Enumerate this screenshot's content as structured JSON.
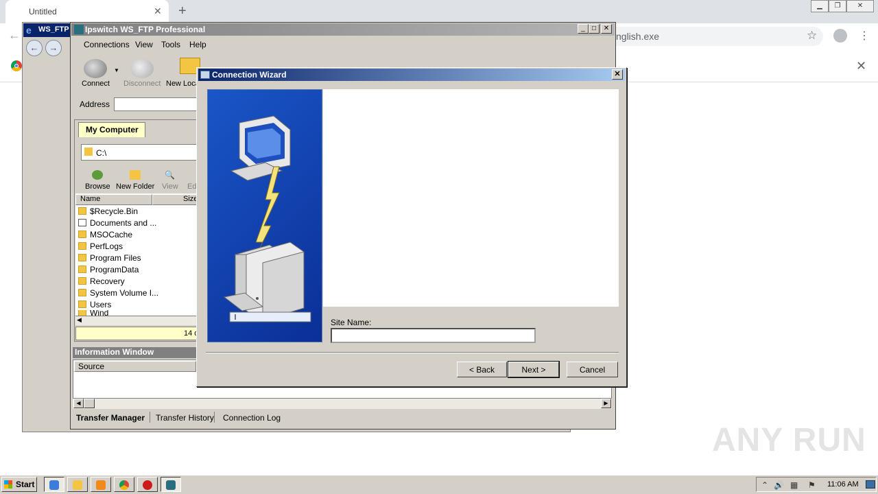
{
  "browser": {
    "tab_title": "Untitled",
    "url_fragment": "nglish.exe"
  },
  "ie": {
    "title": "WS_FTP"
  },
  "ftp": {
    "title": "Ipswitch WS_FTP Professional",
    "menu": [
      "Connections",
      "View",
      "Tools",
      "Help"
    ],
    "toolbar": {
      "connect": "Connect",
      "disconnect": "Disconnect",
      "new_local": "New Loca"
    },
    "address_label": "Address",
    "pane": {
      "tab": "My Computer",
      "path": "C:\\",
      "tools": [
        "Browse",
        "New Folder",
        "View",
        "Edi"
      ],
      "col_name": "Name",
      "col_size": "Size",
      "files": [
        "$Recycle.Bin",
        "Documents and ...",
        "MSOCache",
        "PerfLogs",
        "Program Files",
        "ProgramData",
        "Recovery",
        "System Volume I...",
        "Users",
        "Wind"
      ],
      "status": "14 o"
    },
    "info_window": {
      "title": "Information Window",
      "col_source": "Source"
    },
    "bottom_tabs": [
      "Transfer Manager",
      "Transfer History",
      "Connection Log"
    ]
  },
  "wizard": {
    "title": "Connection Wizard",
    "site_name_label": "Site Name:",
    "site_name_value": "",
    "back": "< Back",
    "next": "Next >",
    "cancel": "Cancel"
  },
  "watermark": "ANY RUN",
  "taskbar": {
    "start": "Start",
    "time": "11:06 AM"
  }
}
